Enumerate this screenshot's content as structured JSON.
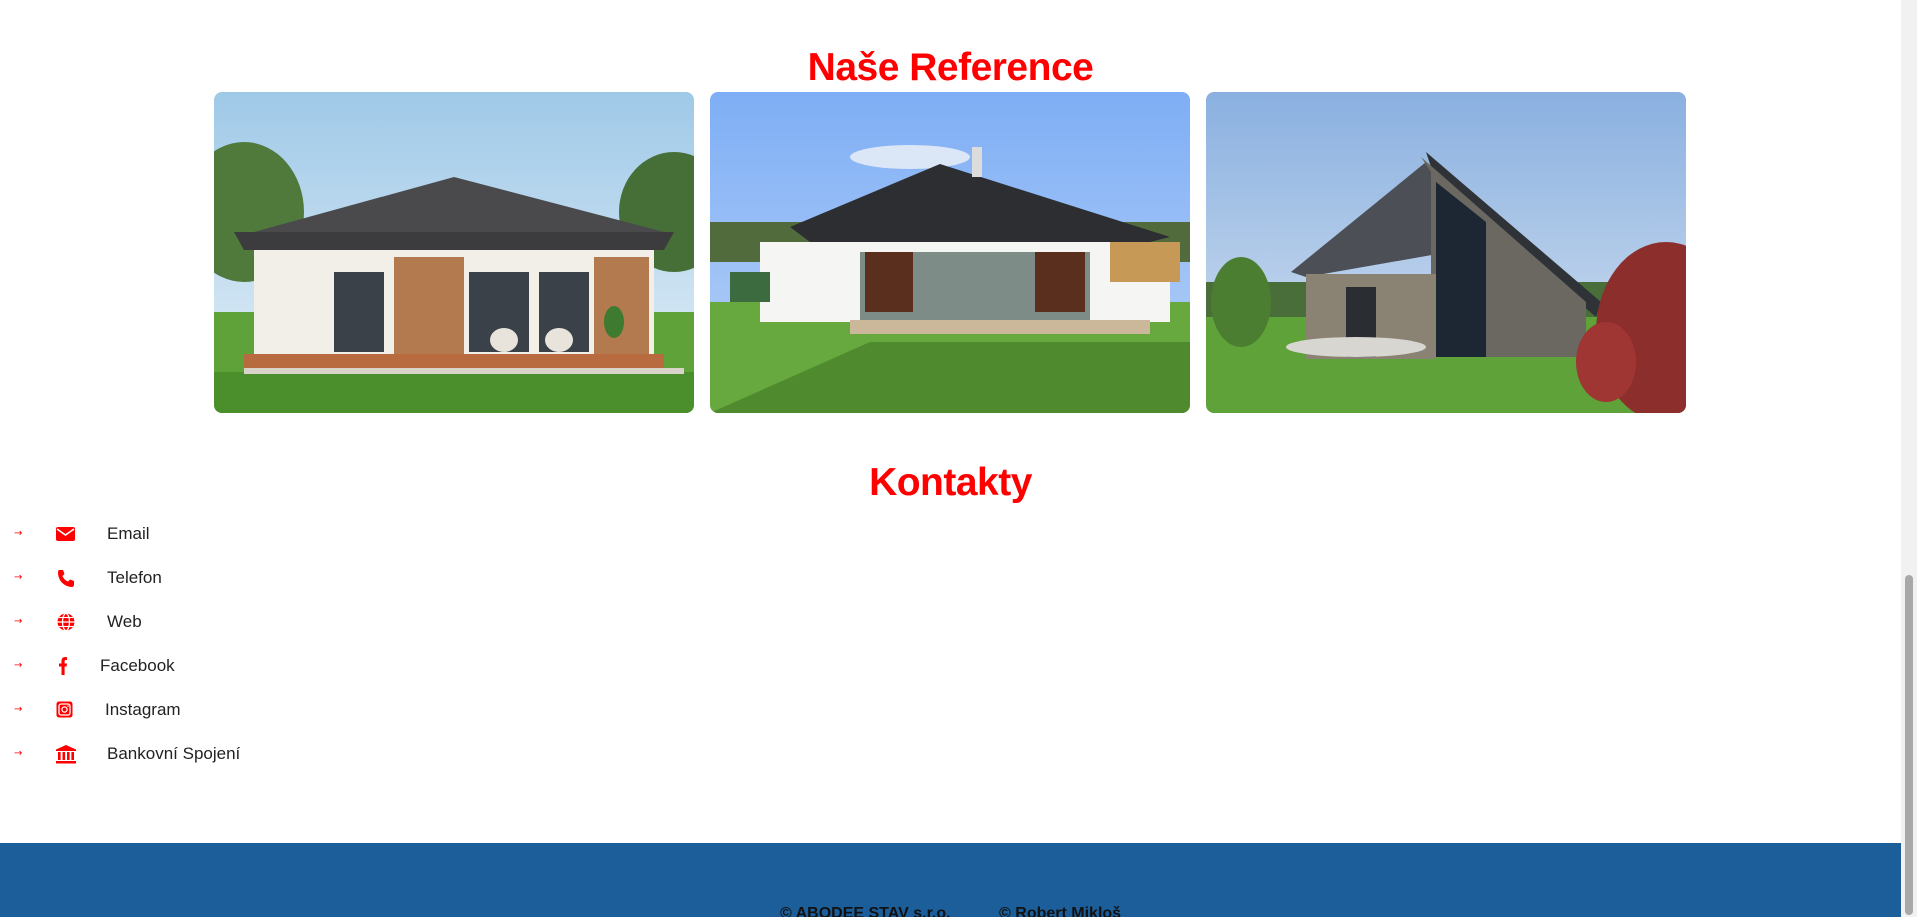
{
  "references": {
    "title": "Naše Reference",
    "photos": [
      {
        "name": "reference-photo-bungalow"
      },
      {
        "name": "reference-photo-white-house"
      },
      {
        "name": "reference-photo-stone-house"
      }
    ]
  },
  "contacts": {
    "title": "Kontakty",
    "items": [
      {
        "label": "Email",
        "icon": "envelope-icon"
      },
      {
        "label": "Telefon",
        "icon": "phone-icon"
      },
      {
        "label": "Web",
        "icon": "globe-icon"
      },
      {
        "label": "Facebook",
        "icon": "facebook-icon"
      },
      {
        "label": "Instagram",
        "icon": "instagram-icon"
      },
      {
        "label": "Bankovní Spojení",
        "icon": "bank-icon"
      }
    ],
    "bullet": "→"
  },
  "footer": {
    "company": "© ABODEE STAV s.r.o.",
    "author": "© Robert Mikloš"
  },
  "colors": {
    "accent": "#ff0000",
    "footer_bg": "#1b5e99",
    "text": "#222222"
  }
}
